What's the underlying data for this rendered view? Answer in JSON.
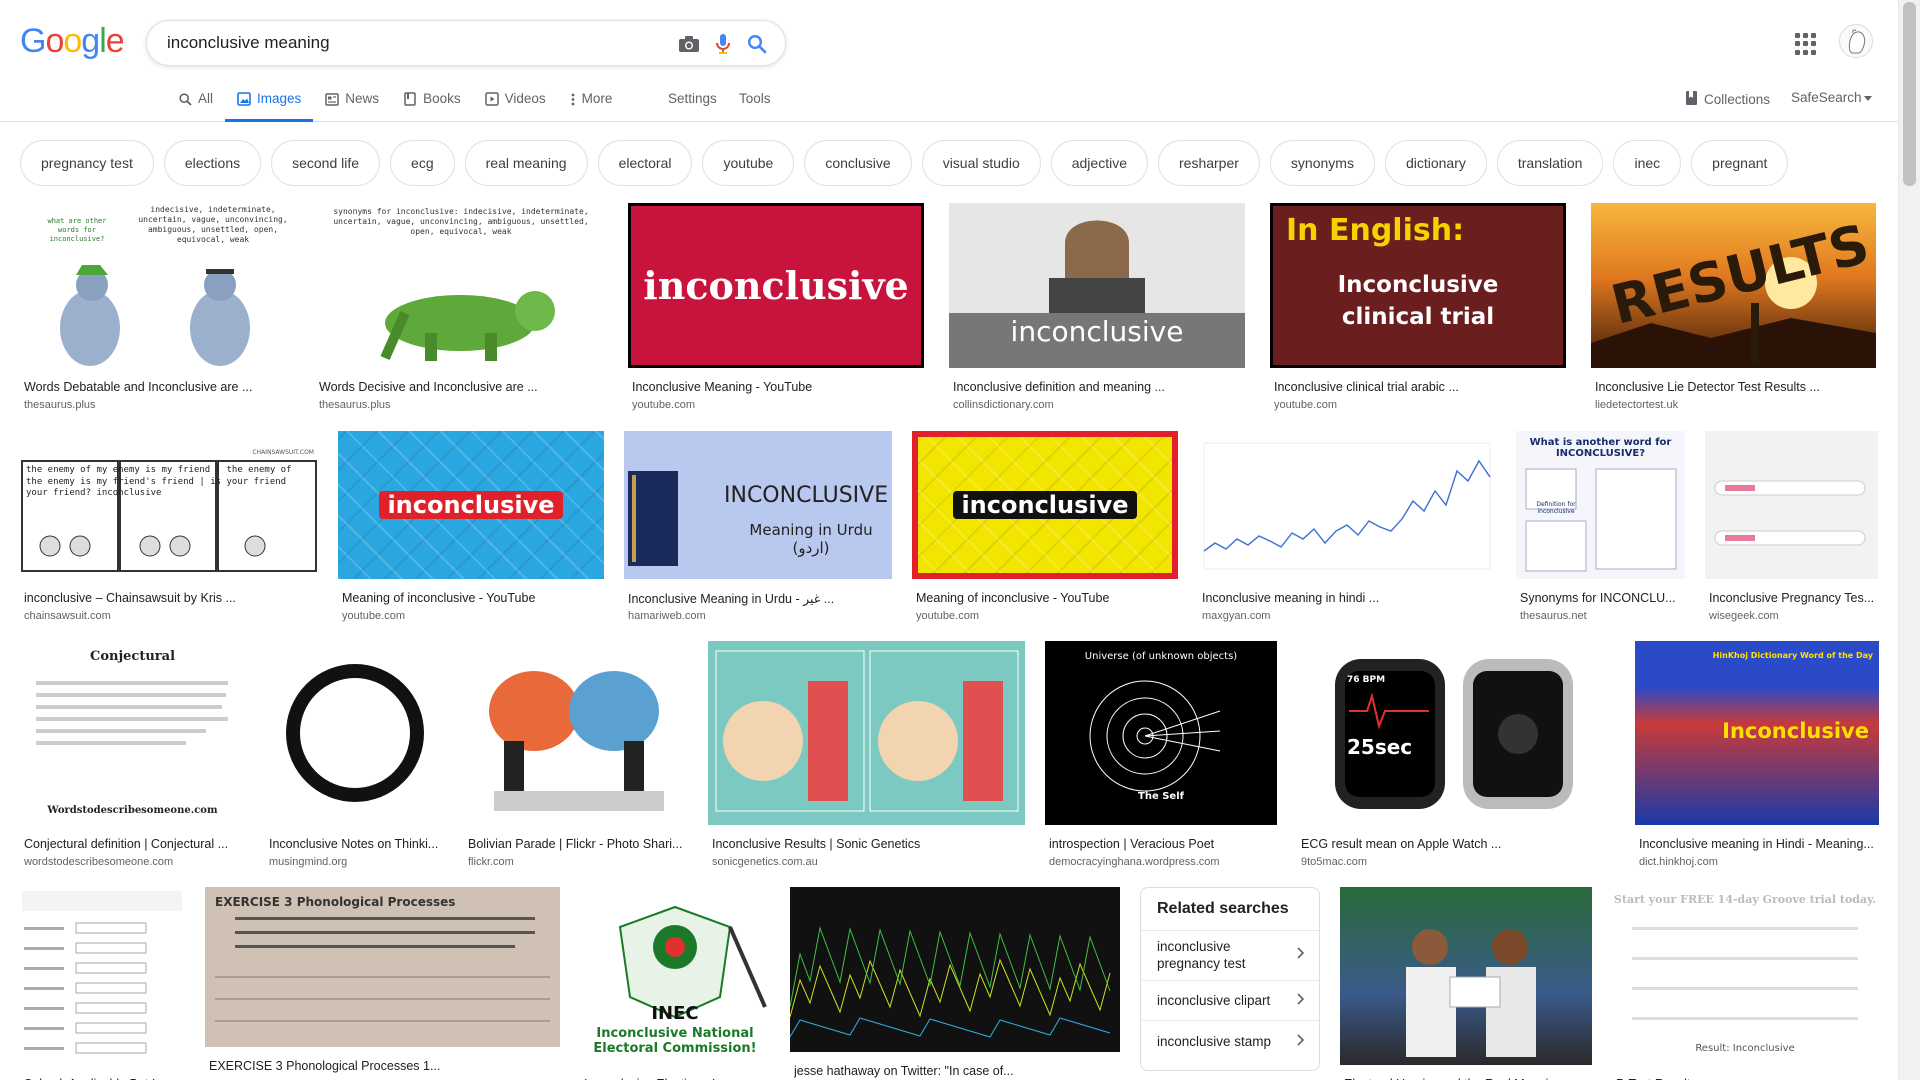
{
  "header": {
    "logo_letters": [
      {
        "ch": "G",
        "color": "#4285f4"
      },
      {
        "ch": "o",
        "color": "#ea4335"
      },
      {
        "ch": "o",
        "color": "#fbbc05"
      },
      {
        "ch": "g",
        "color": "#4285f4"
      },
      {
        "ch": "l",
        "color": "#34a853"
      },
      {
        "ch": "e",
        "color": "#ea4335"
      }
    ],
    "search_value": "inconclusive meaning",
    "icons": [
      "camera-icon",
      "microphone-icon",
      "search-icon",
      "apps-grid-icon"
    ]
  },
  "tabs": [
    {
      "label": "All",
      "icon": "search-icon",
      "active": false
    },
    {
      "label": "Images",
      "icon": "image-icon",
      "active": true
    },
    {
      "label": "News",
      "icon": "news-icon",
      "active": false
    },
    {
      "label": "Books",
      "icon": "book-icon",
      "active": false
    },
    {
      "label": "Videos",
      "icon": "video-icon",
      "active": false
    },
    {
      "label": "More",
      "icon": "more-vert-icon",
      "active": false
    }
  ],
  "toolbar": {
    "settings_label": "Settings",
    "tools_label": "Tools",
    "collections_label": "Collections",
    "safesearch_label": "SafeSearch"
  },
  "chips": [
    "pregnancy test",
    "elections",
    "second life",
    "ecg",
    "real meaning",
    "electoral",
    "youtube",
    "conclusive",
    "visual studio",
    "adjective",
    "resharper",
    "synonyms",
    "dictionary",
    "translation",
    "inec",
    "pregnant"
  ],
  "results": [
    {
      "title": "Words Debatable and Inconclusive are ...",
      "site": "thesaurus.plus",
      "thumb_text": "indecisive, indeterminate, uncertain, vague, unconvincing, ambiguous, unsettled, open, equivocal, weak",
      "thumb_label": "what are other words for inconclusive?",
      "colors": {
        "bg": "#ffffff",
        "fg": "#333333"
      }
    },
    {
      "title": "Words Decisive and Inconclusive are ...",
      "site": "thesaurus.plus",
      "thumb_text": "synonyms for inconclusive: indecisive, indeterminate, uncertain, vague, unconvincing, ambiguous, unsettled, open, equivocal, weak",
      "colors": {
        "bg": "#ffffff",
        "fg": "#333333"
      }
    },
    {
      "title": "Inconclusive Meaning - YouTube",
      "site": "youtube.com",
      "thumb_text": "inconclusive",
      "colors": {
        "bg": "#c8143c",
        "fg": "#ffffff"
      }
    },
    {
      "title": "Inconclusive definition and meaning ...",
      "site": "collinsdictionary.com",
      "thumb_text": "inconclusive",
      "colors": {
        "bg": "#e6e6e6",
        "fg": "#ffffff"
      }
    },
    {
      "title": "Inconclusive clinical trial arabic ...",
      "site": "youtube.com",
      "thumb_text": "Inconclusive clinical trial",
      "thumb_label": "In English:",
      "colors": {
        "bg": "#6b1e1e",
        "fg": "#ffffff",
        "accent": "#f6d200"
      }
    },
    {
      "title": "Inconclusive Lie Detector Test Results ...",
      "site": "liedetectortest.uk",
      "thumb_text": "RESULTS",
      "colors": {
        "bg": "#e07820",
        "fg": "#2a1a0a"
      }
    },
    {
      "title": "inconclusive – Chainsawsuit by Kris ...",
      "site": "chainsawsuit.com",
      "thumb_text": "the enemy of my enemy is my friend | the enemy of the enemy is my friend's friend | is your friend your friend? inconclusive",
      "thumb_label": "CHAINSAWSUIT.COM",
      "colors": {
        "bg": "#ffffff",
        "fg": "#222222"
      }
    },
    {
      "title": "Meaning of inconclusive - YouTube",
      "site": "youtube.com",
      "thumb_text": "inconclusive",
      "colors": {
        "bg": "#2aa6e0",
        "fg": "#ffffff",
        "accent": "#e0202a"
      }
    },
    {
      "title": "Inconclusive Meaning in Urdu - غیر ...",
      "site": "hamariweb.com",
      "thumb_text": "INCONCLUSIVE",
      "thumb_label": "Meaning in Urdu (اردو)",
      "colors": {
        "bg": "#b9c8ee",
        "fg": "#222222"
      }
    },
    {
      "title": "Meaning of inconclusive - YouTube",
      "site": "youtube.com",
      "thumb_text": "inconclusive",
      "colors": {
        "bg": "#f2e600",
        "fg": "#ffffff",
        "accent": "#e0202a"
      }
    },
    {
      "title": "Inconclusive meaning in hindi ...",
      "site": "maxgyan.com",
      "colors": {
        "bg": "#ffffff",
        "fg": "#3b6fd4"
      }
    },
    {
      "title": "Synonyms for INCONCLU...",
      "site": "thesaurus.net",
      "thumb_text": "What is another word for INCONCLUSIVE?",
      "thumb_label": "Definition for inconclusive",
      "colors": {
        "bg": "#f4f6fb",
        "fg": "#1a2a6c"
      }
    },
    {
      "title": "Inconclusive Pregnancy Tes...",
      "site": "wisegeek.com",
      "colors": {
        "bg": "#f2f2f2",
        "fg": "#e87a9a"
      }
    },
    {
      "title": "Conjectural definition | Conjectural ...",
      "site": "wordstodescribesomeone.com",
      "thumb_text": "Conjectural",
      "thumb_label": "Wordstodescribesomeone.com",
      "colors": {
        "bg": "#ffffff",
        "fg": "#222222"
      }
    },
    {
      "title": "Inconclusive Notes on Thinki...",
      "site": "musingmind.org",
      "colors": {
        "bg": "#ffffff",
        "fg": "#111111"
      }
    },
    {
      "title": "Bolivian Parade | Flickr - Photo Shari...",
      "site": "flickr.com",
      "colors": {
        "bg": "#ffffff",
        "fg": "#222222"
      }
    },
    {
      "title": "Inconclusive Results | Sonic Genetics",
      "site": "sonicgenetics.com.au",
      "colors": {
        "bg": "#7cc9c2",
        "fg": "#ffffff",
        "accent": "#e05050"
      }
    },
    {
      "title": "introspection | Veracious Poet",
      "site": "democracyinghana.wordpress.com",
      "thumb_text": "Universe (of unknown objects)",
      "thumb_label": "The Self",
      "colors": {
        "bg": "#000000",
        "fg": "#ffffff"
      }
    },
    {
      "title": "ECG result mean on Apple Watch ...",
      "site": "9to5mac.com",
      "thumb_text": "25sec",
      "thumb_label": "76 BPM",
      "colors": {
        "bg": "#ffffff",
        "fg": "#ffffff",
        "accent": "#e03030"
      }
    },
    {
      "title": "Inconclusive meaning in Hindi - Meaning...",
      "site": "dict.hinkhoj.com",
      "thumb_text": "Inconclusive",
      "thumb_label": "HinKhoj Dictionary Word of the Day",
      "colors": {
        "bg": "#1a3aa8",
        "fg": "#ffe000"
      }
    },
    {
      "title": "Solved: Applicable But Inc...",
      "site": "",
      "colors": {
        "bg": "#ffffff",
        "fg": "#333333"
      }
    },
    {
      "title": "EXERCISE 3 Phonological Processes 1...",
      "site": "",
      "thumb_text": "EXERCISE 3   Phonological Processes",
      "colors": {
        "bg": "#cfc2b4",
        "fg": "#333333"
      }
    },
    {
      "title": "Inconclusive Election - Inec...",
      "site": "",
      "thumb_text": "Inconclusive National Electoral Commission!",
      "thumb_label": "INEC",
      "colors": {
        "bg": "#ffffff",
        "fg": "#1a7a2a"
      }
    },
    {
      "title": "jesse hathaway on Twitter: \"In case of...",
      "site": "",
      "colors": {
        "bg": "#111111",
        "fg": "#e0e040"
      }
    },
    {
      "title": "Electoral Umpire and the Real Meaning...",
      "site": "",
      "colors": {
        "bg": "#2a6a3a",
        "fg": "#ffffff"
      }
    },
    {
      "title": "P-Test Results",
      "site": "",
      "thumb_text": "Start your FREE 14-day Groove trial today.",
      "thumb_label": "Result: Inconclusive",
      "colors": {
        "bg": "#ffffff",
        "fg": "#333333"
      }
    }
  ],
  "related": {
    "heading": "Related searches",
    "items": [
      "inconclusive pregnancy test",
      "inconclusive clipart",
      "inconclusive stamp"
    ]
  }
}
